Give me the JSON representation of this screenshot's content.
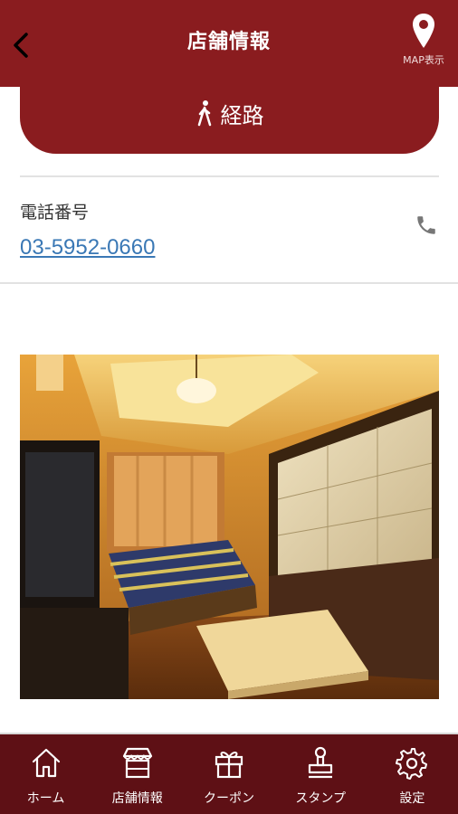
{
  "header": {
    "title": "店舗情報",
    "map_label": "MAP表示"
  },
  "route": {
    "label": "経路"
  },
  "phone": {
    "title": "電話番号",
    "number": "03-5952-0660"
  },
  "nav": {
    "items": [
      {
        "label": "ホーム",
        "icon": "home-icon"
      },
      {
        "label": "店舗情報",
        "icon": "store-icon"
      },
      {
        "label": "クーポン",
        "icon": "gift-icon"
      },
      {
        "label": "スタンプ",
        "icon": "stamp-icon"
      },
      {
        "label": "設定",
        "icon": "gear-icon"
      }
    ]
  },
  "colors": {
    "header_bg": "#8a1c1f",
    "nav_bg": "#5e1015",
    "link": "#3a78b5"
  }
}
